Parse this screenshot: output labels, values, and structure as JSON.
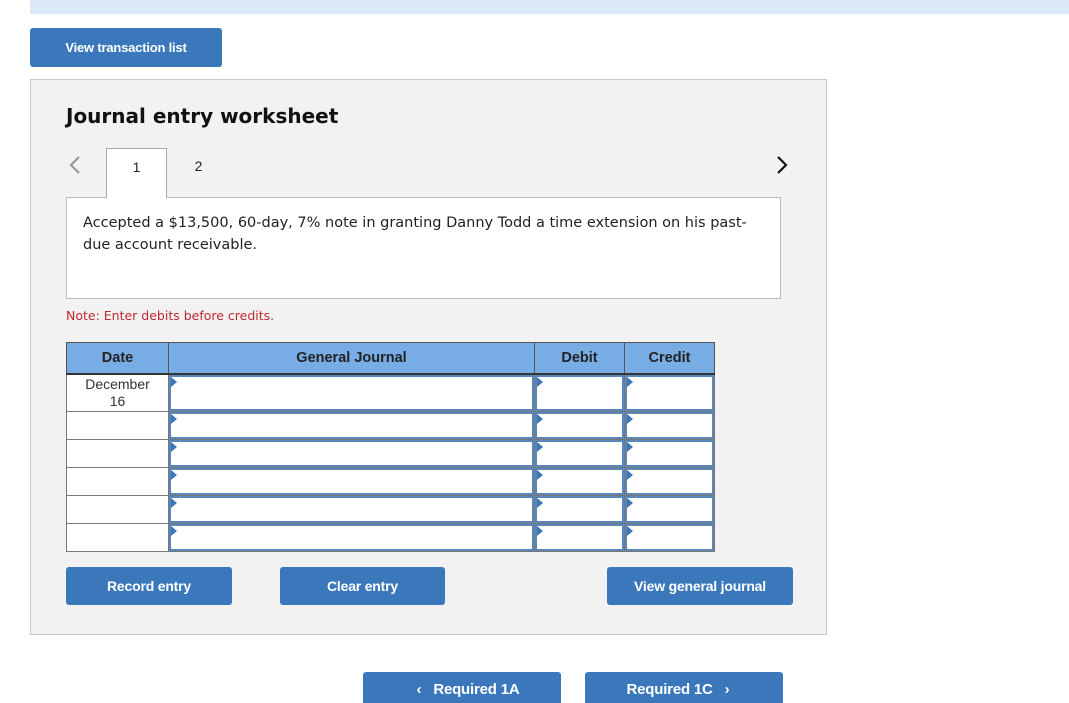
{
  "header": {
    "view_transaction_list_label": "View transaction list"
  },
  "worksheet": {
    "title": "Journal entry worksheet",
    "tabs": [
      {
        "label": "1",
        "active": true
      },
      {
        "label": "2",
        "active": false
      }
    ],
    "prev_icon": "chevron-left-icon",
    "next_icon": "chevron-right-icon",
    "description": "Accepted a $13,500, 60-day, 7% note in granting Danny Todd a time extension on his past-due account receivable.",
    "note": "Note: Enter debits before credits.",
    "table": {
      "headers": [
        "Date",
        "General Journal",
        "Debit",
        "Credit"
      ],
      "rows": [
        {
          "date_line1": "December",
          "date_line2": "16",
          "account": "",
          "debit": "",
          "credit": ""
        },
        {
          "date_line1": "",
          "date_line2": "",
          "account": "",
          "debit": "",
          "credit": ""
        },
        {
          "date_line1": "",
          "date_line2": "",
          "account": "",
          "debit": "",
          "credit": ""
        },
        {
          "date_line1": "",
          "date_line2": "",
          "account": "",
          "debit": "",
          "credit": ""
        },
        {
          "date_line1": "",
          "date_line2": "",
          "account": "",
          "debit": "",
          "credit": ""
        },
        {
          "date_line1": "",
          "date_line2": "",
          "account": "",
          "debit": "",
          "credit": ""
        }
      ]
    },
    "buttons": {
      "record_entry": "Record entry",
      "clear_entry": "Clear entry",
      "view_general_journal": "View general journal"
    }
  },
  "navigation": {
    "prev_label": "Required 1A",
    "next_label": "Required 1C",
    "prev_chevron": "‹",
    "next_chevron": "›"
  },
  "colors": {
    "button_blue": "#3a77bb",
    "header_blue": "#78ace4",
    "note_red": "#c0282d",
    "panel_gray": "#f2f2f2"
  }
}
